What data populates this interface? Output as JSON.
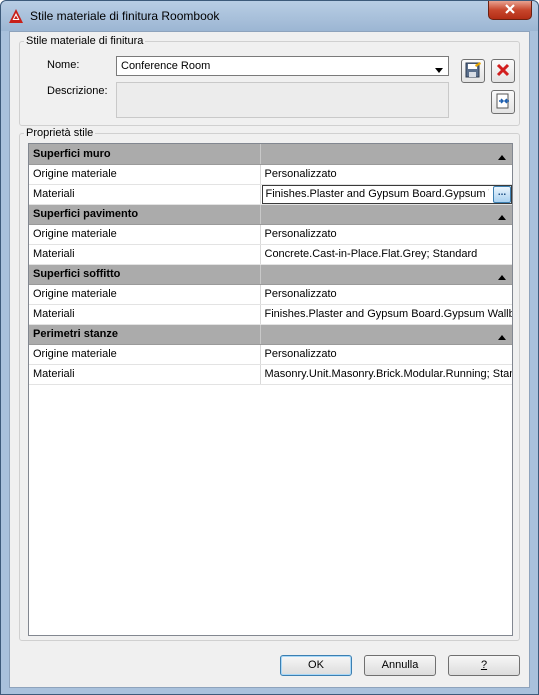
{
  "window": {
    "title": "Stile materiale di finitura Roombook",
    "app_icon": "autocad-icon",
    "close_icon": "close-icon"
  },
  "style_group": {
    "label": "Stile materiale di finitura",
    "name_label": "Nome:",
    "name_value": "Conference Room",
    "description_label": "Descrizione:",
    "description_value": "",
    "save_icon": "save-icon",
    "delete_icon": "delete-icon",
    "import_icon": "import-export-icon"
  },
  "properties": {
    "label": "Proprietà stile",
    "categories": [
      {
        "name": "Superfici muro",
        "rows": [
          {
            "key": "Origine materiale",
            "value": "Personalizzato"
          },
          {
            "key": "Materiali",
            "value": "Finishes.Plaster and Gypsum Board.Gypsum Wallboard.Painted.White; Standard",
            "editing": true,
            "browse_label": "..."
          }
        ]
      },
      {
        "name": "Superfici pavimento",
        "rows": [
          {
            "key": "Origine materiale",
            "value": "Personalizzato"
          },
          {
            "key": "Materiali",
            "value": "Concrete.Cast-in-Place.Flat.Grey; Standard"
          }
        ]
      },
      {
        "name": "Superfici soffitto",
        "rows": [
          {
            "key": "Origine materiale",
            "value": "Personalizzato"
          },
          {
            "key": "Materiali",
            "value": "Finishes.Plaster and Gypsum Board.Gypsum Wallboard.Painted.White; Standard"
          }
        ]
      },
      {
        "name": "Perimetri stanze",
        "rows": [
          {
            "key": "Origine materiale",
            "value": "Personalizzato"
          },
          {
            "key": "Materiali",
            "value": "Masonry.Unit.Masonry.Brick.Modular.Running; Standard"
          }
        ]
      }
    ]
  },
  "buttons": {
    "ok": "OK",
    "cancel": "Annulla",
    "help": "?"
  },
  "colors": {
    "category_bg": "#ababab",
    "accent": "#3c7fb1",
    "close": "#c7462c"
  }
}
